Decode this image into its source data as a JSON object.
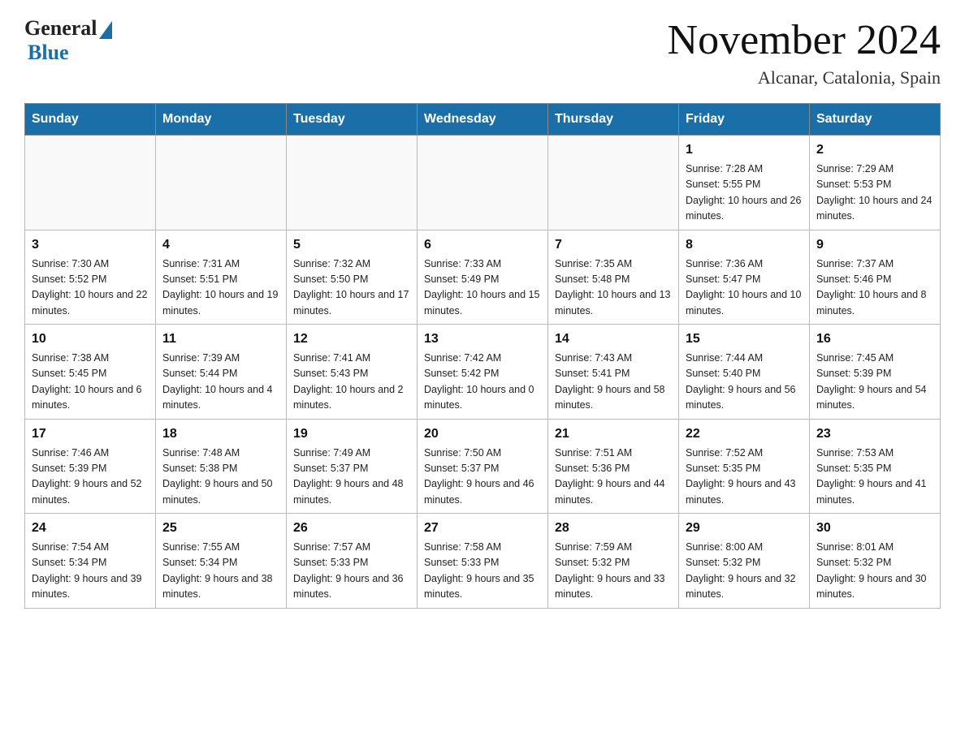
{
  "header": {
    "logo_general": "General",
    "logo_blue": "Blue",
    "title": "November 2024",
    "subtitle": "Alcanar, Catalonia, Spain"
  },
  "days_of_week": [
    "Sunday",
    "Monday",
    "Tuesday",
    "Wednesday",
    "Thursday",
    "Friday",
    "Saturday"
  ],
  "weeks": [
    [
      {
        "day": "",
        "info": ""
      },
      {
        "day": "",
        "info": ""
      },
      {
        "day": "",
        "info": ""
      },
      {
        "day": "",
        "info": ""
      },
      {
        "day": "",
        "info": ""
      },
      {
        "day": "1",
        "info": "Sunrise: 7:28 AM\nSunset: 5:55 PM\nDaylight: 10 hours and 26 minutes."
      },
      {
        "day": "2",
        "info": "Sunrise: 7:29 AM\nSunset: 5:53 PM\nDaylight: 10 hours and 24 minutes."
      }
    ],
    [
      {
        "day": "3",
        "info": "Sunrise: 7:30 AM\nSunset: 5:52 PM\nDaylight: 10 hours and 22 minutes."
      },
      {
        "day": "4",
        "info": "Sunrise: 7:31 AM\nSunset: 5:51 PM\nDaylight: 10 hours and 19 minutes."
      },
      {
        "day": "5",
        "info": "Sunrise: 7:32 AM\nSunset: 5:50 PM\nDaylight: 10 hours and 17 minutes."
      },
      {
        "day": "6",
        "info": "Sunrise: 7:33 AM\nSunset: 5:49 PM\nDaylight: 10 hours and 15 minutes."
      },
      {
        "day": "7",
        "info": "Sunrise: 7:35 AM\nSunset: 5:48 PM\nDaylight: 10 hours and 13 minutes."
      },
      {
        "day": "8",
        "info": "Sunrise: 7:36 AM\nSunset: 5:47 PM\nDaylight: 10 hours and 10 minutes."
      },
      {
        "day": "9",
        "info": "Sunrise: 7:37 AM\nSunset: 5:46 PM\nDaylight: 10 hours and 8 minutes."
      }
    ],
    [
      {
        "day": "10",
        "info": "Sunrise: 7:38 AM\nSunset: 5:45 PM\nDaylight: 10 hours and 6 minutes."
      },
      {
        "day": "11",
        "info": "Sunrise: 7:39 AM\nSunset: 5:44 PM\nDaylight: 10 hours and 4 minutes."
      },
      {
        "day": "12",
        "info": "Sunrise: 7:41 AM\nSunset: 5:43 PM\nDaylight: 10 hours and 2 minutes."
      },
      {
        "day": "13",
        "info": "Sunrise: 7:42 AM\nSunset: 5:42 PM\nDaylight: 10 hours and 0 minutes."
      },
      {
        "day": "14",
        "info": "Sunrise: 7:43 AM\nSunset: 5:41 PM\nDaylight: 9 hours and 58 minutes."
      },
      {
        "day": "15",
        "info": "Sunrise: 7:44 AM\nSunset: 5:40 PM\nDaylight: 9 hours and 56 minutes."
      },
      {
        "day": "16",
        "info": "Sunrise: 7:45 AM\nSunset: 5:39 PM\nDaylight: 9 hours and 54 minutes."
      }
    ],
    [
      {
        "day": "17",
        "info": "Sunrise: 7:46 AM\nSunset: 5:39 PM\nDaylight: 9 hours and 52 minutes."
      },
      {
        "day": "18",
        "info": "Sunrise: 7:48 AM\nSunset: 5:38 PM\nDaylight: 9 hours and 50 minutes."
      },
      {
        "day": "19",
        "info": "Sunrise: 7:49 AM\nSunset: 5:37 PM\nDaylight: 9 hours and 48 minutes."
      },
      {
        "day": "20",
        "info": "Sunrise: 7:50 AM\nSunset: 5:37 PM\nDaylight: 9 hours and 46 minutes."
      },
      {
        "day": "21",
        "info": "Sunrise: 7:51 AM\nSunset: 5:36 PM\nDaylight: 9 hours and 44 minutes."
      },
      {
        "day": "22",
        "info": "Sunrise: 7:52 AM\nSunset: 5:35 PM\nDaylight: 9 hours and 43 minutes."
      },
      {
        "day": "23",
        "info": "Sunrise: 7:53 AM\nSunset: 5:35 PM\nDaylight: 9 hours and 41 minutes."
      }
    ],
    [
      {
        "day": "24",
        "info": "Sunrise: 7:54 AM\nSunset: 5:34 PM\nDaylight: 9 hours and 39 minutes."
      },
      {
        "day": "25",
        "info": "Sunrise: 7:55 AM\nSunset: 5:34 PM\nDaylight: 9 hours and 38 minutes."
      },
      {
        "day": "26",
        "info": "Sunrise: 7:57 AM\nSunset: 5:33 PM\nDaylight: 9 hours and 36 minutes."
      },
      {
        "day": "27",
        "info": "Sunrise: 7:58 AM\nSunset: 5:33 PM\nDaylight: 9 hours and 35 minutes."
      },
      {
        "day": "28",
        "info": "Sunrise: 7:59 AM\nSunset: 5:32 PM\nDaylight: 9 hours and 33 minutes."
      },
      {
        "day": "29",
        "info": "Sunrise: 8:00 AM\nSunset: 5:32 PM\nDaylight: 9 hours and 32 minutes."
      },
      {
        "day": "30",
        "info": "Sunrise: 8:01 AM\nSunset: 5:32 PM\nDaylight: 9 hours and 30 minutes."
      }
    ]
  ]
}
